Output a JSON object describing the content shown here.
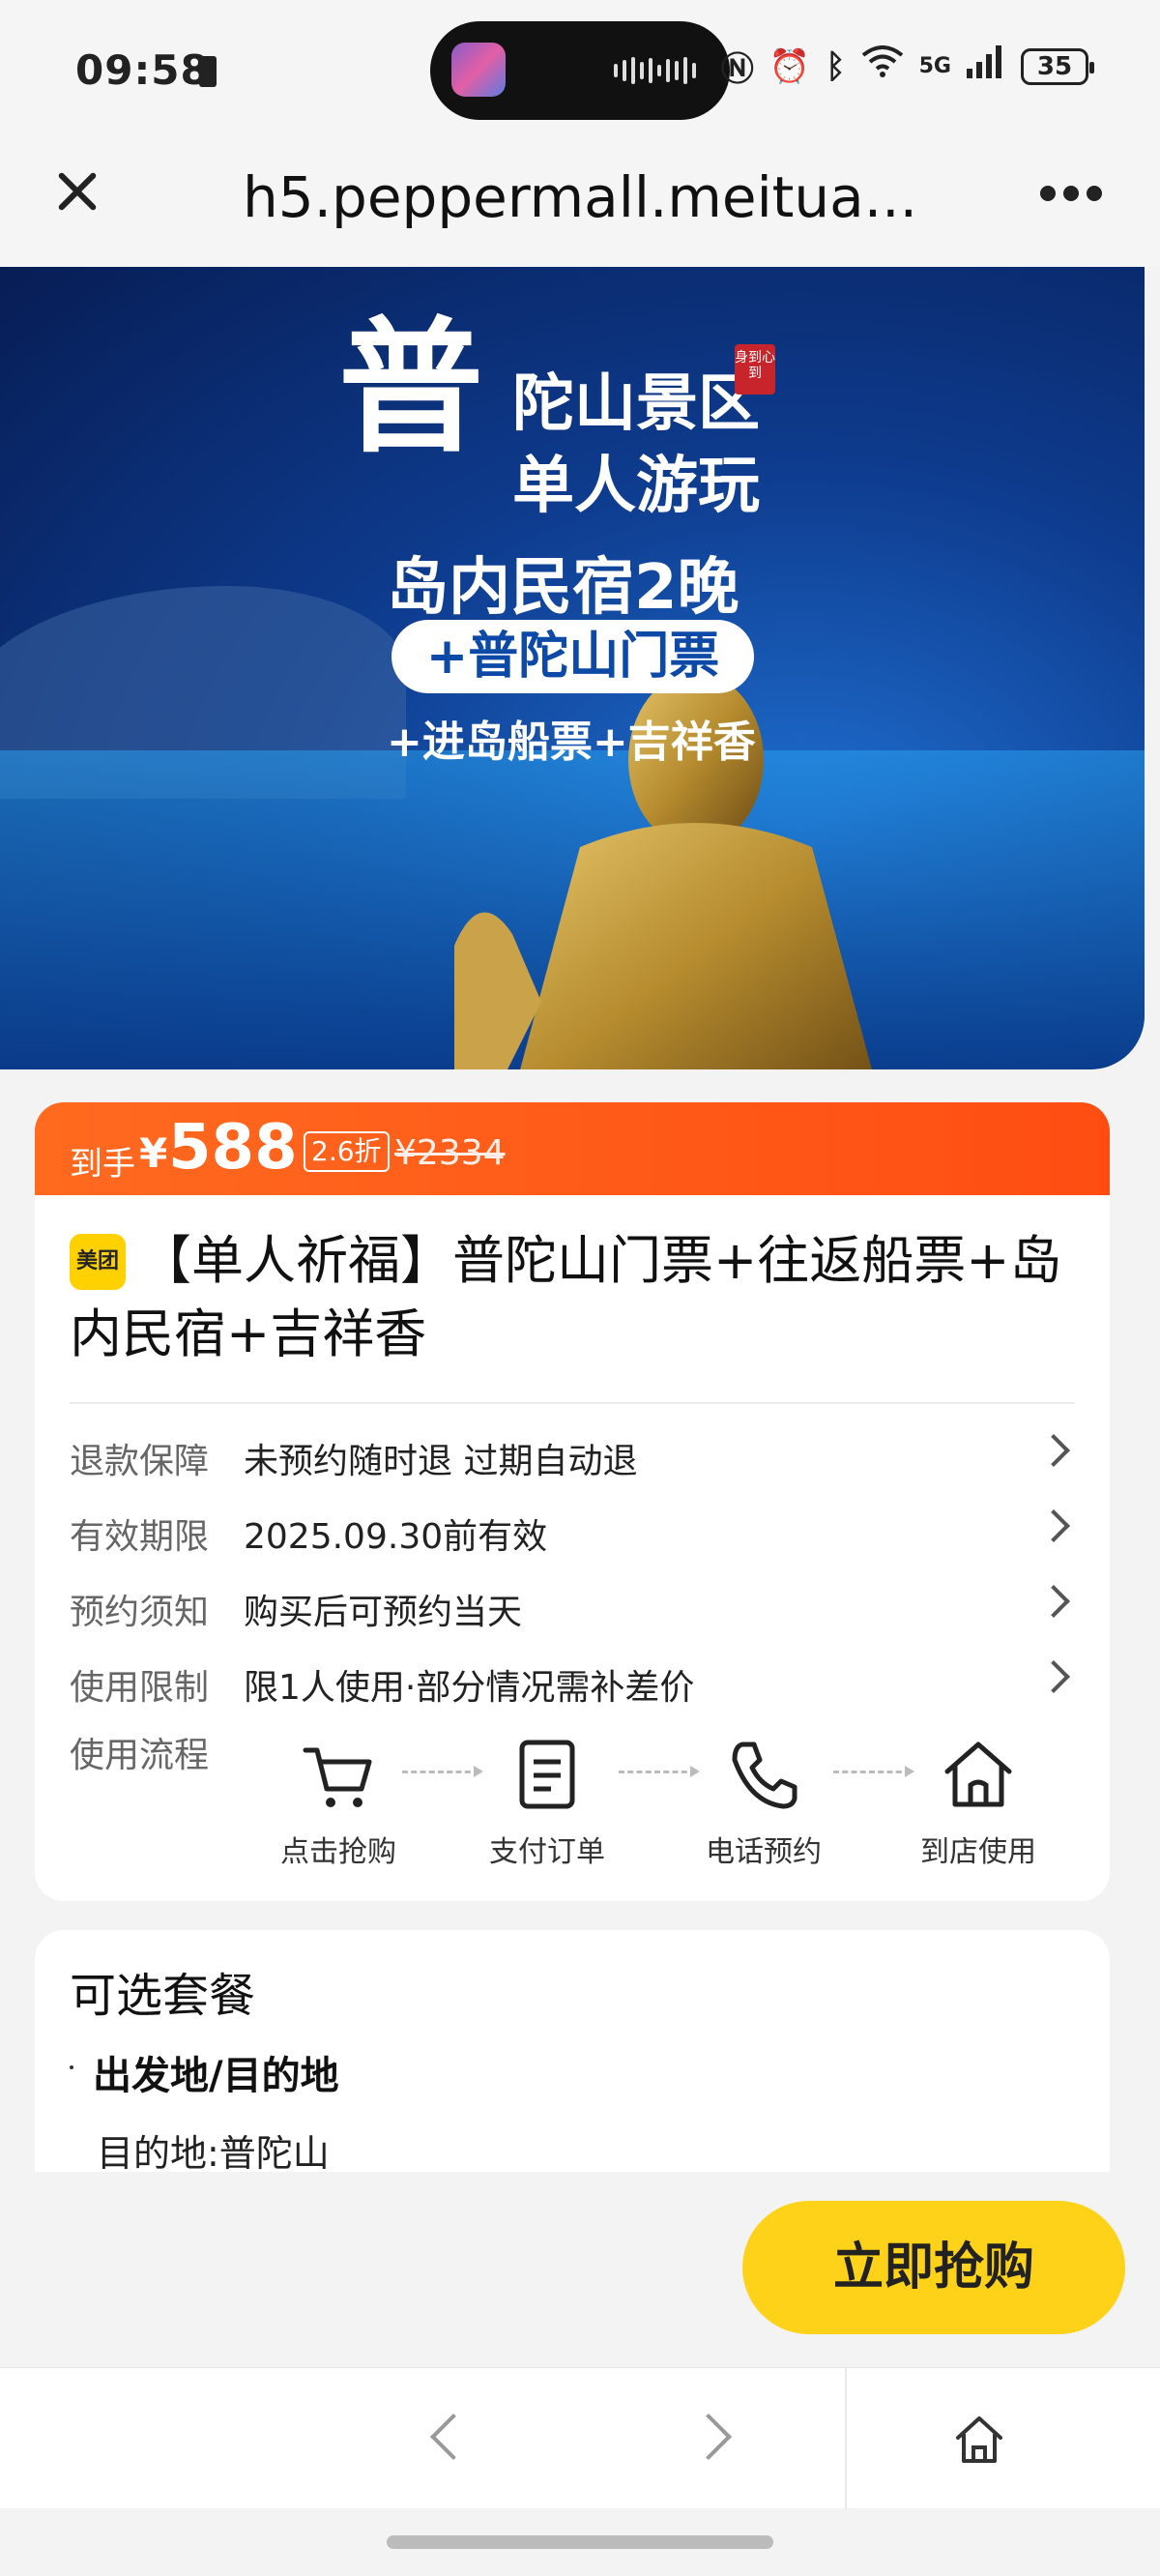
{
  "status_bar": {
    "time": "09:58",
    "network": "5G",
    "battery": "35"
  },
  "browser": {
    "url": "h5.peppermall.meitua..."
  },
  "banner": {
    "title_char": "普",
    "line1": "陀山景区",
    "line2": "单人游玩",
    "line3": "岛内民宿2晚",
    "pill": "+普陀山门票",
    "line4": "+进岛船票+吉祥香",
    "seal": "身到心到"
  },
  "price": {
    "label": "到手",
    "currency": "¥",
    "amount": "588",
    "discount": "2.6折",
    "original": "¥2334"
  },
  "product": {
    "badge": "美团",
    "title": "【单人祈福】普陀山门票+往返船票+岛内民宿+吉祥香",
    "info": [
      {
        "key": "退款保障",
        "value": "未预约随时退 过期自动退"
      },
      {
        "key": "有效期限",
        "value": "2025.09.30前有效"
      },
      {
        "key": "预约须知",
        "value": "购买后可预约当天"
      },
      {
        "key": "使用限制",
        "value": "限1人使用·部分情况需补差价"
      }
    ],
    "flow_label": "使用流程",
    "steps": [
      {
        "label": "点击抢购",
        "icon": "cart-icon"
      },
      {
        "label": "支付订单",
        "icon": "document-icon"
      },
      {
        "label": "电话预约",
        "icon": "phone-icon"
      },
      {
        "label": "到店使用",
        "icon": "home-icon"
      }
    ]
  },
  "options": {
    "heading": "可选套餐",
    "subheading": "出发地/目的地",
    "destination": "目的地:普陀山"
  },
  "buy_button": "立即抢购"
}
